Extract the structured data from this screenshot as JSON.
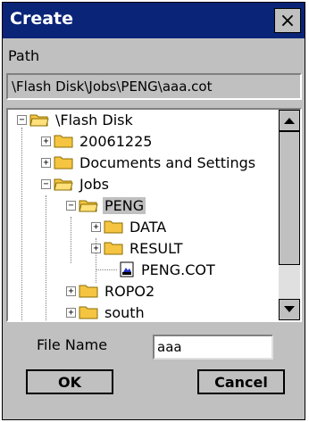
{
  "dialog": {
    "title": "Create",
    "close_glyph": "×",
    "path_label": "Path",
    "path_value": "\\Flash Disk\\Jobs\\PENG\\aaa.cot"
  },
  "tree": {
    "items": [
      {
        "label": "\\Flash Disk",
        "icon": "folder-open-icon",
        "expander": "−",
        "selected": false
      },
      {
        "label": "20061225",
        "icon": "folder-icon",
        "expander": "+",
        "selected": false
      },
      {
        "label": "Documents and Settings",
        "icon": "folder-icon",
        "expander": "+",
        "selected": false
      },
      {
        "label": "Jobs",
        "icon": "folder-open-icon",
        "expander": "−",
        "selected": false
      },
      {
        "label": "PENG",
        "icon": "folder-open-icon",
        "expander": "−",
        "selected": true
      },
      {
        "label": "DATA",
        "icon": "folder-icon",
        "expander": "+",
        "selected": false
      },
      {
        "label": "RESULT",
        "icon": "folder-icon",
        "expander": "+",
        "selected": false
      },
      {
        "label": "PENG.COT",
        "icon": "file-icon",
        "expander": "",
        "selected": false
      },
      {
        "label": "ROPO2",
        "icon": "folder-icon",
        "expander": "+",
        "selected": false
      },
      {
        "label": "south",
        "icon": "folder-icon",
        "expander": "+",
        "selected": false
      }
    ]
  },
  "form": {
    "file_name_label": "File Name",
    "file_name_value": "aaa",
    "ok_label": "OK",
    "cancel_label": "Cancel"
  },
  "colors": {
    "titlebar": "#0a2478",
    "dialog_bg": "#c0c0c0",
    "folder": "#f5c542"
  }
}
